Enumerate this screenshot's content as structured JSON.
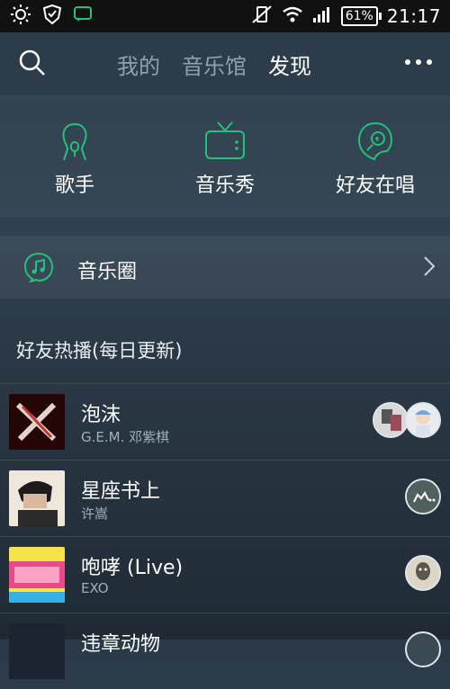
{
  "status_bar": {
    "battery": "61%",
    "time": "21:17"
  },
  "header": {
    "tabs": [
      "我的",
      "音乐馆",
      "发现"
    ],
    "active_tab": "发现"
  },
  "quick_actions": [
    {
      "label": "歌手",
      "icon": "singer-icon"
    },
    {
      "label": "音乐秀",
      "icon": "tv-icon"
    },
    {
      "label": "好友在唱",
      "icon": "karaoke-icon"
    }
  ],
  "music_circle": {
    "label": "音乐圈",
    "icon": "music-note-icon"
  },
  "friends_hot": {
    "title": "好友热播(每日更新)",
    "items": [
      {
        "title": "泡沫",
        "artist": "G.E.M. 邓紫棋"
      },
      {
        "title": "星座书上",
        "artist": "许嵩"
      },
      {
        "title": "咆哮 (Live)",
        "artist": "EXO"
      },
      {
        "title": "违章动物",
        "artist": ""
      }
    ]
  },
  "colors": {
    "accent": "#22c27a",
    "status_bar": "#111111",
    "inactive_tab": "#8fa0ae"
  }
}
